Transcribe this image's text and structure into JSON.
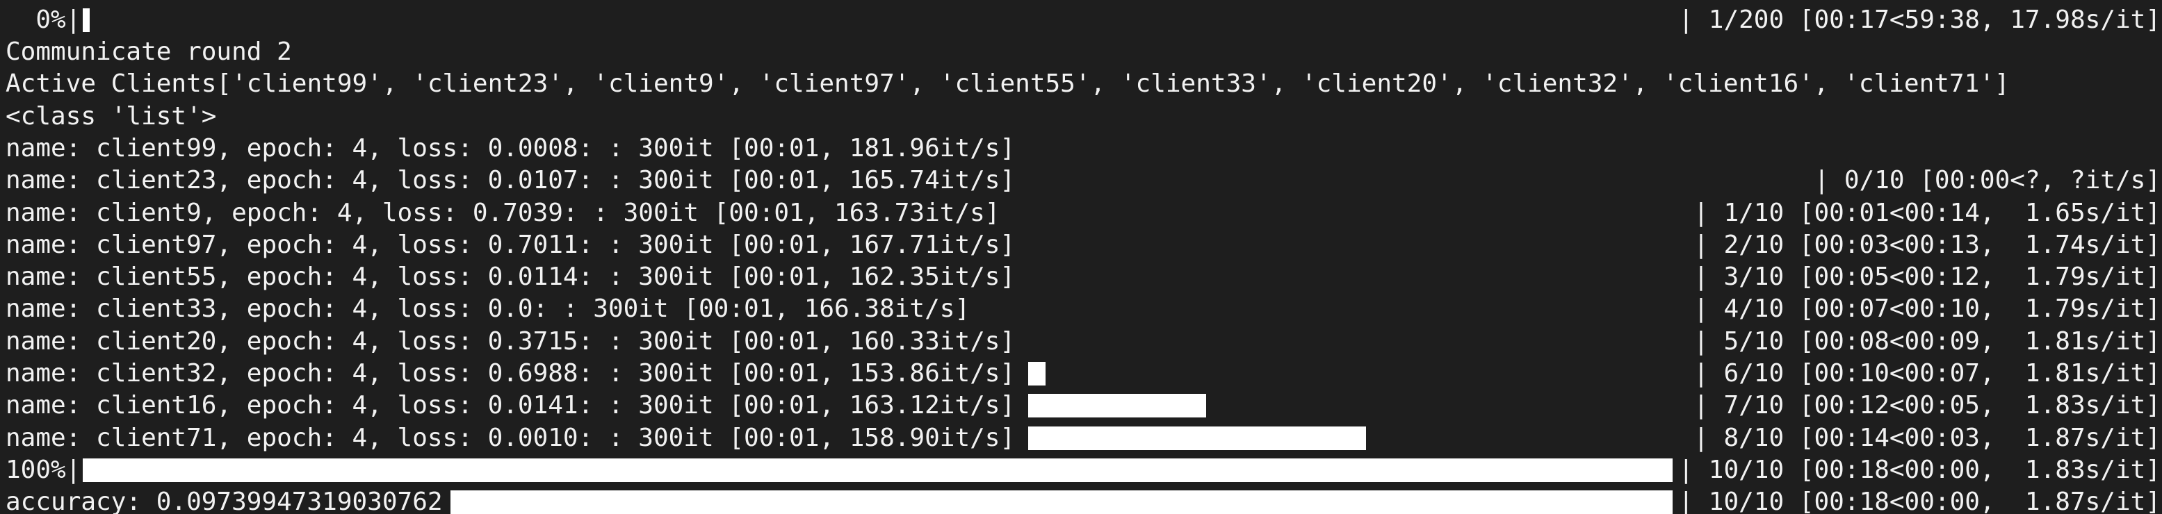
{
  "terminal": {
    "top_progress": {
      "left": "  0%|",
      "right": "| 1/200 [00:17<59:38, 17.98s/it]"
    },
    "lines": [
      "Communicate round 2",
      "Active Clients['client99', 'client23', 'client9', 'client97', 'client55', 'client33', 'client20', 'client32', 'client16', 'client71']",
      "<class 'list'>",
      "name: client99, epoch: 4, loss: 0.0008: : 300it [00:01, 181.96it/s]",
      "name: client23, epoch: 4, loss: 0.0107: : 300it [00:01, 165.74it/s]",
      "name: client9, epoch: 4, loss: 0.7039: : 300it [00:01, 163.73it/s]",
      "name: client97, epoch: 4, loss: 0.7011: : 300it [00:01, 167.71it/s]",
      "name: client55, epoch: 4, loss: 0.0114: : 300it [00:01, 162.35it/s]",
      "name: client33, epoch: 4, loss: 0.0: : 300it [00:01, 166.38it/s]",
      "name: client20, epoch: 4, loss: 0.3715: : 300it [00:01, 160.33it/s]",
      "name: client32, epoch: 4, loss: 0.6988: : 300it [00:01, 153.86it/s]",
      "name: client16, epoch: 4, loss: 0.0141: : 300it [00:01, 163.12it/s]",
      "name: client71, epoch: 4, loss: 0.0010: : 300it [00:01, 158.90it/s]",
      "100%|",
      "accuracy: 0.09739947319030762"
    ],
    "right_status": [
      "| 0/10 [00:00<?, ?it/s]",
      "| 1/10 [00:01<00:14,  1.65s/it]",
      "| 2/10 [00:03<00:13,  1.74s/it]",
      "| 3/10 [00:05<00:12,  1.79s/it]",
      "| 4/10 [00:07<00:10,  1.79s/it]",
      "| 5/10 [00:08<00:09,  1.81s/it]",
      "| 6/10 [00:10<00:07,  1.81s/it]",
      "| 7/10 [00:12<00:05,  1.83s/it]",
      "| 8/10 [00:14<00:03,  1.87s/it]",
      "| 10/10 [00:18<00:00,  1.83s/it]",
      "| 10/10 [00:18<00:00,  1.87s/it]"
    ],
    "round_progress": {
      "done": 1,
      "total": 200
    },
    "client_progress_steps": [
      6,
      7,
      8,
      10,
      10
    ]
  }
}
